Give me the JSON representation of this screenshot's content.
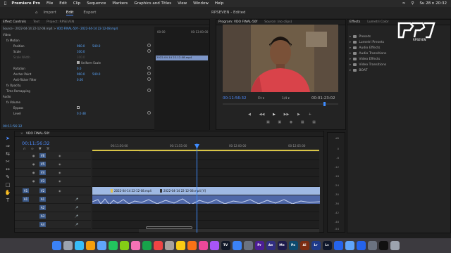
{
  "menubar": {
    "app_name": "Premiere Pro",
    "items": [
      "File",
      "Edit",
      "Clip",
      "Sequence",
      "Markers",
      "Graphics and Titles",
      "View",
      "Window",
      "Help"
    ],
    "clock": "Su 28 n 20:32"
  },
  "header": {
    "workspaces": [
      "Import",
      "Edit",
      "Export"
    ],
    "active_workspace": "Edit",
    "project_title": "RPSEVEN",
    "edited": "- Edited"
  },
  "effect_controls": {
    "tabs": [
      "Effect Controls",
      "Text",
      "Project: RPSEVEN"
    ],
    "source_label": "Source - 2022-04-14 22-12-08.mp4",
    "sequence_label": "VDO FINAL-50f - 2022-04-14 22-12-08.mp4",
    "timecode_start": "00:00",
    "timecode_end": "00:13:00:00",
    "clip_name": "2022-04-14 22-12-08.mp4",
    "section_video": "Video",
    "rows": [
      {
        "label": "fx  Motion",
        "indent": 1
      },
      {
        "label": "Position",
        "v1": "960.0",
        "v2": "540.0"
      },
      {
        "label": "Scale",
        "v1": "100.0"
      },
      {
        "label": "Scale Width",
        "v1": "100.0"
      },
      {
        "label": "Uniform Scale"
      },
      {
        "label": "Rotation",
        "v1": "0.0"
      },
      {
        "label": "Anchor Point",
        "v1": "960.0",
        "v2": "540.0"
      },
      {
        "label": "Anti-flicker Filter",
        "v1": "0.00"
      },
      {
        "label": "fx  Opacity"
      },
      {
        "label": "Time Remapping"
      },
      {
        "label": "Audio"
      },
      {
        "label": "fx  Volume"
      },
      {
        "label": "Bypass"
      },
      {
        "label": "Level",
        "v1": "0.0 dB"
      }
    ],
    "current_time": "00:11:56:32"
  },
  "program_monitor": {
    "tabs": [
      "Program: VDO FINAL-50f",
      "Source: (no clips)"
    ],
    "time_current": "00:11:56:32",
    "fit": "Fit",
    "resolution": "1/4",
    "time_duration": "00:01:23:02"
  },
  "effects_panel": {
    "tabs": [
      "Effects",
      "Lumetri Color"
    ],
    "items": [
      "Presets",
      "Lumetri Presets",
      "Audio Effects",
      "Audio Transitions",
      "Video Effects",
      "Video Transitions",
      "BOAT"
    ]
  },
  "timeline": {
    "sequence_name": "VDO FINAL-50f",
    "timecode": "00:11:56:32",
    "ruler_labels": [
      "00:11:50:00",
      "00:11:55:00",
      "00:12:00:00",
      "00:12:05:00"
    ],
    "video_tracks": [
      "V6",
      "V5",
      "V4",
      "V3",
      "V2",
      "V1"
    ],
    "audio_tracks": [
      "A1",
      "A2",
      "A3",
      "A4"
    ],
    "clip_left": "2022-04-14 22-12-08.mp4",
    "clip_right": "2022-04-14 22-12-08.mp4 [V]",
    "meter_labels": [
      "0",
      "-6",
      "-12",
      "-18",
      "-24",
      "-30",
      "-36",
      "-42",
      "-48",
      "-54"
    ],
    "meter_unit": "dB"
  },
  "logo": {
    "text": "RPSEVEN"
  },
  "dock": [
    "Finder",
    "Launchpad",
    "Safari",
    "Chrome",
    "Mail",
    "Messages",
    "Maps",
    "Photos",
    "FaceTime",
    "Calendar",
    "Contacts",
    "Notes",
    "Reminders",
    "Music",
    "Podcasts",
    "TV",
    "App Store",
    "Settings",
    "Pr",
    "Ae",
    "Me",
    "Ps",
    "Ai",
    "Lr",
    "Lc",
    "Files",
    "Preview",
    "Zoom",
    "Calc",
    "Terminal",
    "Trash"
  ]
}
